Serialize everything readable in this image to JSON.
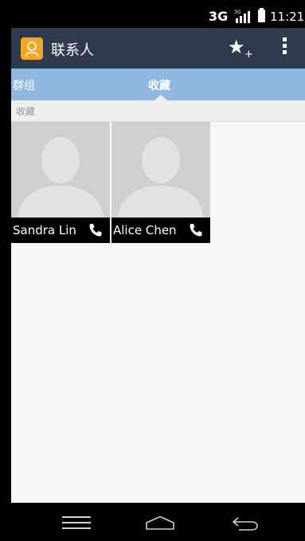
{
  "status_bar": {
    "network": "3G",
    "signal_label": "3G",
    "time": "11:21"
  },
  "action_bar": {
    "title": "联系人",
    "add_favorite_icon": "star-plus-icon",
    "overflow_icon": "overflow-menu-icon"
  },
  "tabs": [
    {
      "label": "群组",
      "selected": false
    },
    {
      "label": "收藏",
      "selected": true
    }
  ],
  "section": {
    "header": "收藏"
  },
  "favorites": [
    {
      "name": "Sandra Lin",
      "icon": "phone-icon"
    },
    {
      "name": "Alice Chen",
      "icon": "phone-icon"
    }
  ],
  "nav_bar": {
    "menu_icon": "menu-icon",
    "home_icon": "home-icon",
    "back_icon": "back-icon"
  },
  "colors": {
    "action_bar": "#2f3a4f",
    "tabs": "#8fb8e0",
    "app_icon": "#f5a623",
    "background": "#f7f7f7"
  }
}
